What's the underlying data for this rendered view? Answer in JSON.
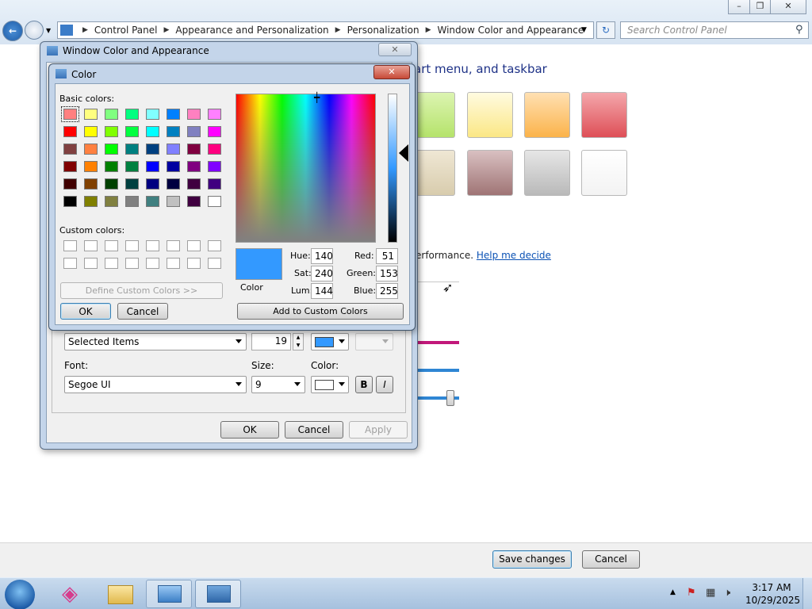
{
  "explorer": {
    "breadcrumb": [
      "Control Panel",
      "Appearance and Personalization",
      "Personalization",
      "Window Color and Appearance"
    ],
    "search_placeholder": "Search Control Panel",
    "heading_fragment": "art menu, and taskbar",
    "performance_fragment": "erformance.",
    "help_link": "Help me decide",
    "save_changes": "Save changes",
    "cancel": "Cancel",
    "swatches": [
      [
        "#b5e36b",
        "#fbe785",
        "#fbb34a",
        "#de4f57"
      ],
      [
        "#d8ccad",
        "#9f7475",
        "#b9b9b9",
        "#f3f3f3"
      ]
    ]
  },
  "wca_dialog": {
    "title": "Window Color and Appearance",
    "item_label": "Selected Items",
    "item_size": "19",
    "item_color1": "#3399ff",
    "font_label": "Font:",
    "font_value": "Segoe UI",
    "size_label": "Size:",
    "size_value": "9",
    "color_label": "Color:",
    "font_color": "#ffffff",
    "bold": "B",
    "italic": "I",
    "ok": "OK",
    "cancel": "Cancel",
    "apply": "Apply"
  },
  "color_dialog": {
    "title": "Color",
    "basic_colors_label": "Basic colors:",
    "custom_colors_label": "Custom colors:",
    "define_custom": "Define Custom Colors >>",
    "ok": "OK",
    "cancel": "Cancel",
    "add_custom": "Add to Custom Colors",
    "color_label": "Color",
    "preview_color": "#3399ff",
    "hue_label": "Hue:",
    "hue": "140",
    "sat_label": "Sat:",
    "sat": "240",
    "lum_label": "Lum:",
    "lum": "144",
    "red_label": "Red:",
    "red": "51",
    "green_label": "Green:",
    "green": "153",
    "blue_label": "Blue:",
    "blue": "255",
    "basic_colors": [
      [
        "#ff8080",
        "#ffff80",
        "#80ff80",
        "#00ff80",
        "#80ffff",
        "#0080ff",
        "#ff80c0",
        "#ff80ff"
      ],
      [
        "#ff0000",
        "#ffff00",
        "#80ff00",
        "#00ff40",
        "#00ffff",
        "#0080c0",
        "#8080c0",
        "#ff00ff"
      ],
      [
        "#804040",
        "#ff8040",
        "#00ff00",
        "#008080",
        "#004080",
        "#8080ff",
        "#800040",
        "#ff0080"
      ],
      [
        "#800000",
        "#ff8000",
        "#008000",
        "#008040",
        "#0000ff",
        "#0000a0",
        "#800080",
        "#8000ff"
      ],
      [
        "#400000",
        "#804000",
        "#004000",
        "#004040",
        "#000080",
        "#000040",
        "#400040",
        "#400080"
      ],
      [
        "#000000",
        "#808000",
        "#808040",
        "#808080",
        "#408080",
        "#c0c0c0",
        "#400040",
        "#ffffff"
      ]
    ]
  },
  "taskbar": {
    "time": "3:17 AM",
    "date": "10/29/2025"
  }
}
